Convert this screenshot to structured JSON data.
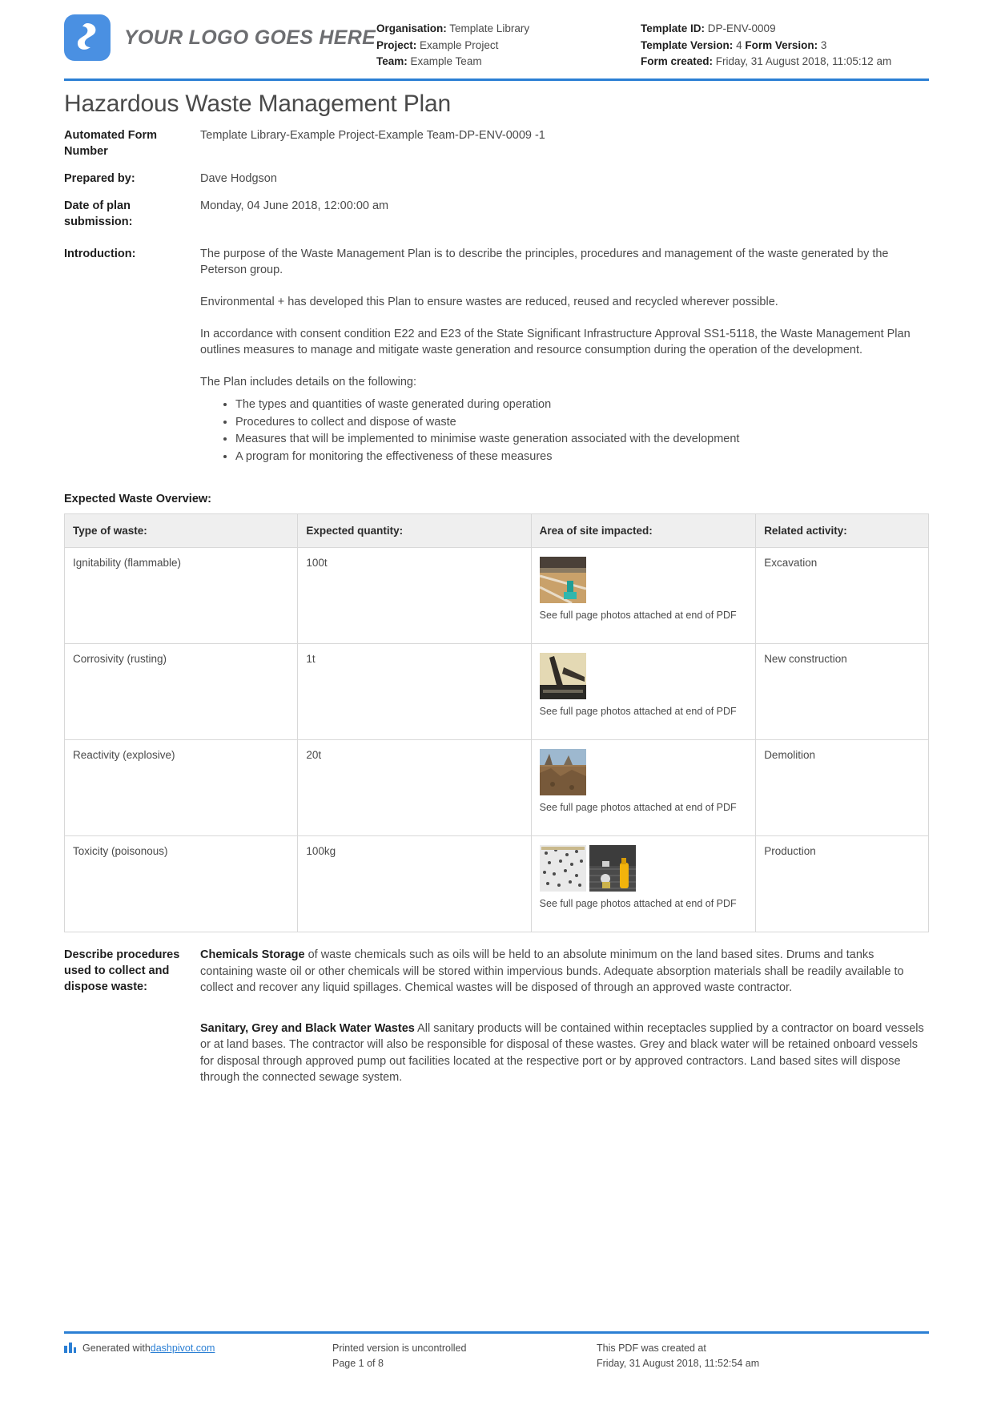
{
  "header": {
    "logo_text": "YOUR LOGO GOES HERE",
    "logo_icon": "dashpivot-logo-icon",
    "organisation_label": "Organisation:",
    "organisation_value": "Template Library",
    "project_label": "Project:",
    "project_value": "Example Project",
    "team_label": "Team:",
    "team_value": "Example Team",
    "template_id_label": "Template ID:",
    "template_id_value": "DP-ENV-0009",
    "template_version_label": "Template Version:",
    "template_version_value": "4",
    "form_version_label": "Form Version:",
    "form_version_value": "3",
    "form_created_label": "Form created:",
    "form_created_value": "Friday, 31 August 2018, 11:05:12 am"
  },
  "title": "Hazardous Waste Management Plan",
  "fields": {
    "automated_form_number_label": "Automated Form Number",
    "automated_form_number_value": "Template Library-Example Project-Example Team-DP-ENV-0009   -1",
    "prepared_by_label": "Prepared by:",
    "prepared_by_value": "Dave Hodgson",
    "date_label": "Date of plan submission:",
    "date_value": "Monday, 04 June 2018, 12:00:00 am",
    "introduction_label": "Introduction:",
    "introduction_paragraphs": [
      "The purpose of the Waste Management Plan is to describe the principles, procedures and management of the waste generated by the Peterson group.",
      "Environmental + has developed this Plan to ensure wastes are reduced, reused and recycled wherever possible.",
      "In accordance with consent condition E22 and E23 of the State Significant Infrastructure Approval SS1-5118, the Waste Management Plan outlines measures to manage and mitigate waste generation and resource consumption during the operation of the development.",
      "The Plan includes details on the following:"
    ],
    "introduction_bullets": [
      "The types and quantities of waste generated during operation",
      "Procedures to collect and dispose of waste",
      "Measures that will be implemented to minimise waste generation associated with the development",
      "A program for monitoring the effectiveness of these measures"
    ]
  },
  "waste_overview": {
    "section_title": "Expected Waste Overview:",
    "columns": [
      "Type of waste:",
      "Expected quantity:",
      "Area of site impacted:",
      "Related activity:"
    ],
    "photo_caption": "See full page photos attached at end of PDF",
    "rows": [
      {
        "type": "Ignitability (flammable)",
        "quantity": "100t",
        "photos": 1,
        "activity": "Excavation"
      },
      {
        "type": "Corrosivity (rusting)",
        "quantity": "1t",
        "photos": 1,
        "activity": "New construction"
      },
      {
        "type": "Reactivity (explosive)",
        "quantity": "20t",
        "photos": 1,
        "activity": "Demolition"
      },
      {
        "type": "Toxicity (poisonous)",
        "quantity": "100kg",
        "photos": 2,
        "activity": "Production"
      }
    ]
  },
  "procedures": {
    "label": "Describe procedures used to collect and dispose waste:",
    "para1_bold": "Chemicals Storage",
    "para1_rest": " of waste chemicals such as oils will be held to an absolute minimum on the land based sites. Drums and tanks containing waste oil or other chemicals will be stored within impervious bunds. Adequate absorption materials shall be readily available to collect and recover any liquid spillages. Chemical wastes will be disposed of through an approved waste contractor.",
    "para2_bold": "Sanitary, Grey and Black Water Wastes",
    "para2_rest": " All sanitary products will be contained within receptacles supplied by a contractor on board vessels or at land bases. The contractor will also be responsible for disposal of these wastes. Grey and black water will be retained onboard vessels for disposal through approved pump out facilities located at the respective port or by approved contractors. Land based sites will dispose through the connected sewage system."
  },
  "footer": {
    "generated_prefix": "Generated with ",
    "generated_link": "dashpivot.com",
    "printed_line1": "Printed version is uncontrolled",
    "printed_line2": "Page 1 of 8",
    "created_line1": "This PDF was created at",
    "created_line2": "Friday, 31 August 2018, 11:52:54 am"
  },
  "colors": {
    "accent": "#2b7fd4",
    "logo_blue": "#4a90e2",
    "table_header": "#efefef"
  }
}
